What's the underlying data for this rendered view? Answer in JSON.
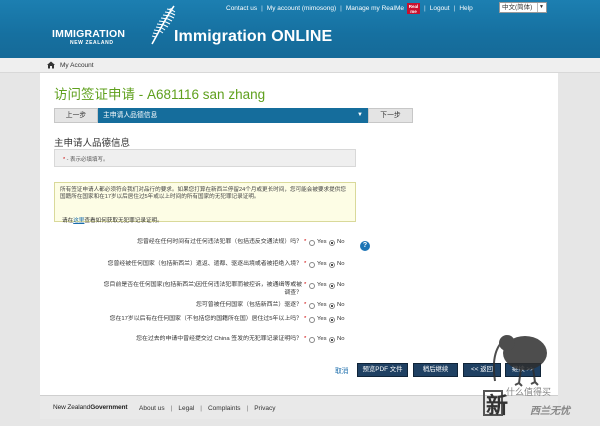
{
  "header": {
    "logo_line1": "IMMIGRATION",
    "logo_line2": "NEW ZEALAND",
    "logo_reg": "®",
    "app_title": "Immigration ONLINE",
    "links": {
      "contact": "Contact us",
      "account": "My account (mimosong)",
      "realme": "Manage my RealMe",
      "realme_badge_top": "Real",
      "realme_badge_bottom": "me",
      "logout": "Logout",
      "help": "Help"
    },
    "language": "中文(简体)"
  },
  "breadcrumb": {
    "label": "My Account"
  },
  "page": {
    "title_cn": "访问签证申请",
    "title_id": " - A681116 san zhang"
  },
  "step_nav": {
    "prev": "上一步",
    "current": "主申请人品德信息",
    "next": "下一步"
  },
  "section": {
    "title": "主申请人品德信息",
    "required_star": "*",
    "required_note": " - 表示必填填写。"
  },
  "info": {
    "text": "所有签证申请人都必须符合我们对品行的要求。如果您打算在新西兰停留24个月或更长时间，您可能会被要求提供您国籍所在国家和在17岁以后居住过5年或以上时间的所有国家的无犯罪记录证明。",
    "link_prefix": "请在",
    "link_text": "这里",
    "link_suffix": "查看如何获取无犯罪记录证明。"
  },
  "questions": [
    {
      "text": "您曾经在任何时间有过任何违法犯罪（包括违反交通法规）吗？",
      "yes": "Yes",
      "no": "No",
      "answer": "No"
    },
    {
      "text": "您曾经被任何国家（包括新西兰）遣返、遣都、驱逐出境或者被拒绝入境？",
      "yes": "Yes",
      "no": "No",
      "answer": "No"
    },
    {
      "text": "您目前是否在任何国家(包括新西兰)因任何违法犯罪而被控诉，被通缉等或被调查？",
      "yes": "Yes",
      "no": "No",
      "answer": "No"
    },
    {
      "text": "您可曾被任何国家（包括新西兰）驱逐？",
      "yes": "Yes",
      "no": "No",
      "answer": "No"
    },
    {
      "text": "您在17岁以后有在任何国家（不包括您的国籍所在国）居住过5年以上吗？",
      "yes": "Yes",
      "no": "No",
      "answer": "No"
    },
    {
      "text": "您在过去的申请中曾经提交过 China 签发的无犯罪记录证明吗？",
      "yes": "Yes",
      "no": "No",
      "answer": "No"
    }
  ],
  "help_icon_glyph": "?",
  "actions": {
    "cancel": "取消",
    "pdf": "预览PDF 文件",
    "save": "稍后继续",
    "back": "<< 返回",
    "continue": "继续 >>"
  },
  "footer": {
    "gov_part1": "New Zealand",
    "gov_part2": "Government",
    "links": [
      "About us",
      "Legal",
      "Complaints",
      "Privacy"
    ]
  },
  "watermark": {
    "char": "新",
    "line1": "什么值得买",
    "line2": "西兰无忧"
  },
  "colors": {
    "header_blue": "#1670a0",
    "title_green": "#5fa01d",
    "step_blue": "#156d9c",
    "button_navy": "#1f4062",
    "required_red": "#c00"
  }
}
